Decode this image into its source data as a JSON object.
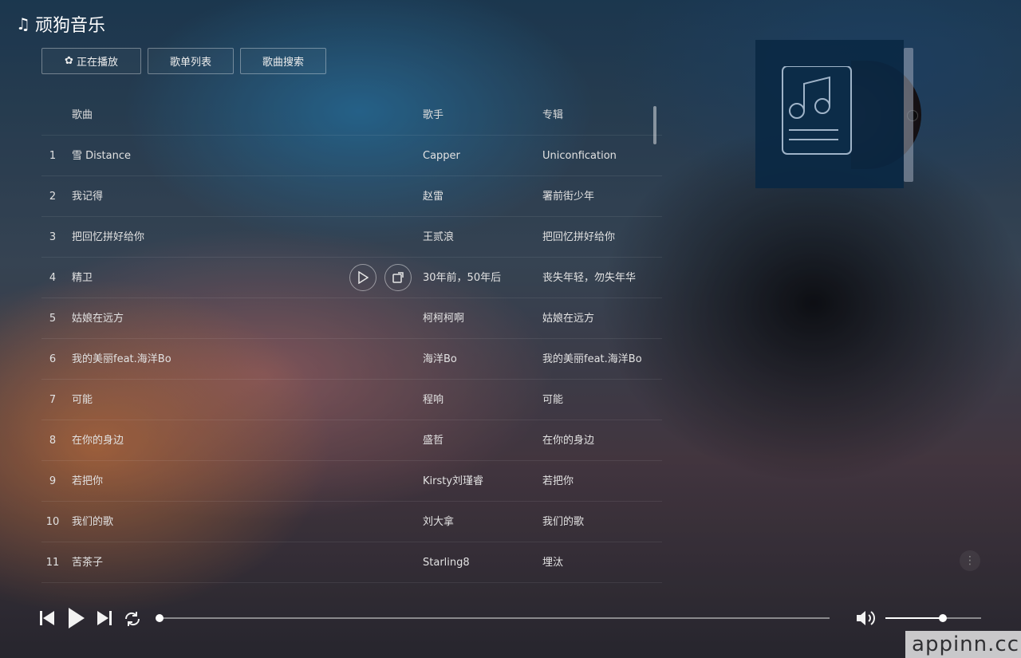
{
  "app": {
    "title_icon": "♫",
    "title": "顽狗音乐"
  },
  "nav": {
    "now_playing_icon": "✿",
    "now_playing": "正在播放",
    "playlist": "歌单列表",
    "search": "歌曲搜索"
  },
  "table": {
    "headers": {
      "title": "歌曲",
      "artist": "歌手",
      "album": "专辑"
    },
    "rows": [
      {
        "num": "1",
        "title": "雪 Distance",
        "artist": "Capper",
        "album": "Uniconfication"
      },
      {
        "num": "2",
        "title": "我记得",
        "artist": "赵雷",
        "album": "署前街少年"
      },
      {
        "num": "3",
        "title": "把回忆拼好给你",
        "artist": "王贰浪",
        "album": "把回忆拼好给你"
      },
      {
        "num": "4",
        "title": "精卫",
        "artist": "30年前，50年后",
        "album": "丧失年轻，勿失年华"
      },
      {
        "num": "5",
        "title": "姑娘在远方",
        "artist": "柯柯柯啊",
        "album": "姑娘在远方"
      },
      {
        "num": "6",
        "title": "我的美丽feat.海洋Bo",
        "artist": "海洋Bo",
        "album": "我的美丽feat.海洋Bo"
      },
      {
        "num": "7",
        "title": "可能",
        "artist": "程响",
        "album": "可能"
      },
      {
        "num": "8",
        "title": "在你的身边",
        "artist": "盛哲",
        "album": "在你的身边"
      },
      {
        "num": "9",
        "title": "若把你",
        "artist": "Kirsty刘瑾睿",
        "album": "若把你"
      },
      {
        "num": "10",
        "title": "我们的歌",
        "artist": "刘大拿",
        "album": "我们的歌"
      },
      {
        "num": "11",
        "title": "苦茶子",
        "artist": "Starling8",
        "album": "埋汰"
      }
    ],
    "hover_row_index": 3
  },
  "player": {
    "progress_fraction": 0.0,
    "volume_fraction": 0.6
  },
  "colors": {
    "accent": "#ffffff"
  },
  "watermark": "appinn.cc"
}
